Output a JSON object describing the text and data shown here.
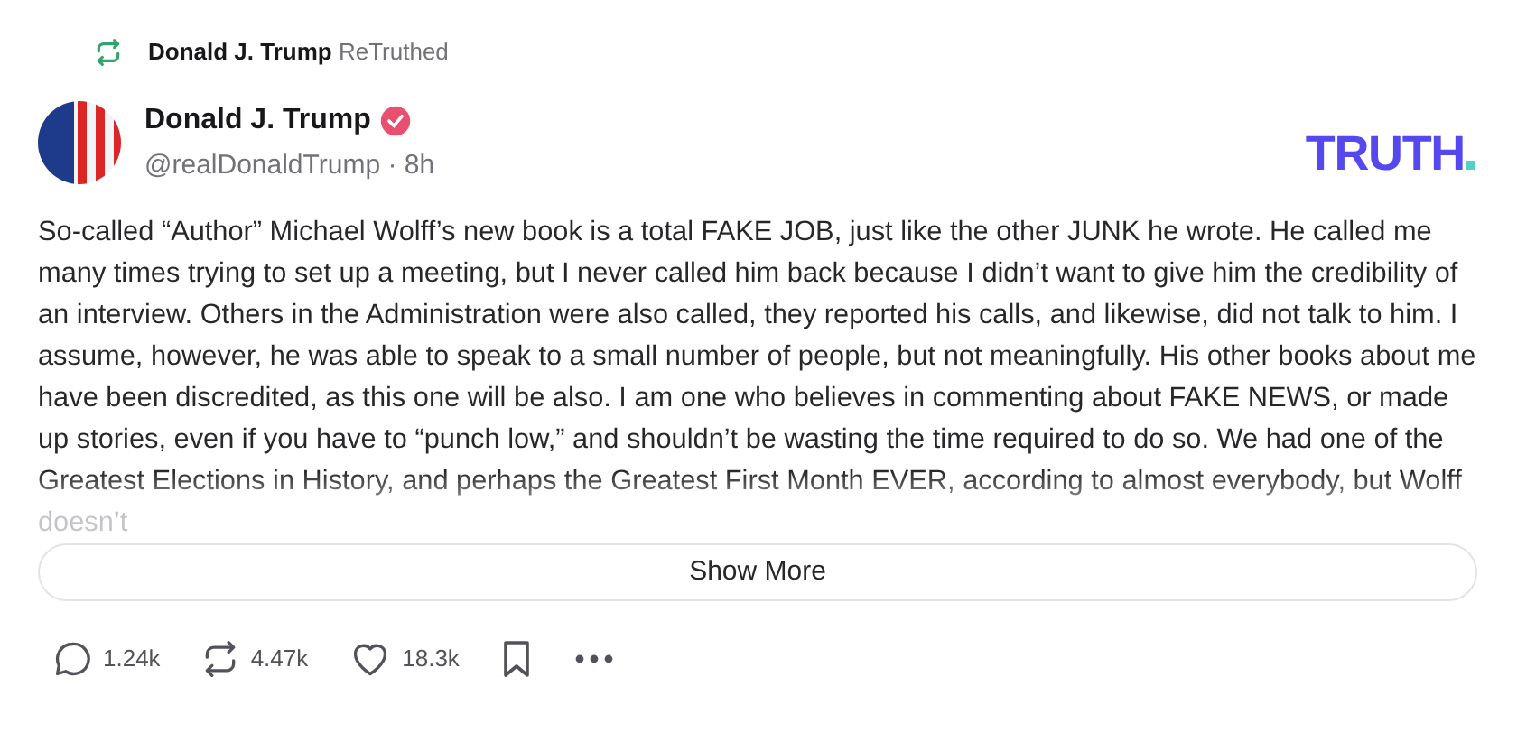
{
  "retruth": {
    "name": "Donald J. Trump",
    "action": "ReTruthed"
  },
  "author": {
    "name": "Donald J. Trump",
    "verified": true,
    "handle": "@realDonaldTrump",
    "separator": "·",
    "time": "8h"
  },
  "logo": {
    "text": "TRUTH"
  },
  "post": {
    "text": "So-called “Author” Michael Wolff’s new book is a total FAKE JOB, just like the other JUNK he wrote. He called me many times trying to set up a meeting, but I never called him back because I didn’t want to give him the credibility of an interview. Others in the Administration were also called, they reported his calls, and likewise, did not talk to him. I assume, however, he was able to speak to a small number of people, but not meaningfully. His other books about me have been discredited, as this one will be also. I am one who believes in commenting about FAKE NEWS, or made up stories, even if you have to “punch low,” and shouldn’t be wasting the time required to do so. We had one of the Greatest Elections in History, and perhaps the Greatest First Month EVER, according to almost everybody, but Wolff doesn’t"
  },
  "show_more": "Show More",
  "actions": [
    {
      "kind": "reply",
      "count": "1.24k"
    },
    {
      "kind": "retruth",
      "count": "4.47k"
    },
    {
      "kind": "like",
      "count": "18.3k"
    },
    {
      "kind": "bookmark"
    },
    {
      "kind": "more"
    }
  ]
}
